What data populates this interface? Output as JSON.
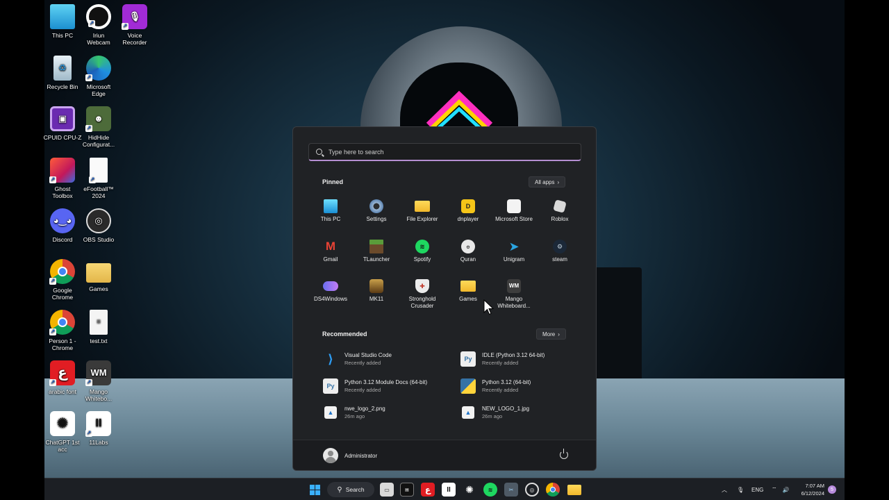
{
  "desktop": {
    "icons": [
      {
        "label": "This PC",
        "icon": "monitor-icon"
      },
      {
        "label": "Iriun\nWebcam",
        "icon": "webcam-icon"
      },
      {
        "label": "Voice\nRecorder",
        "icon": "microphone-icon"
      },
      {
        "label": "Recycle Bin",
        "icon": "recycle-bin-icon"
      },
      {
        "label": "Microsoft\nEdge",
        "icon": "edge-icon"
      },
      {
        "label": "CPUID CPU-Z",
        "icon": "cpu-z-icon"
      },
      {
        "label": "HidHide\nConfigurat...",
        "icon": "hidhide-icon"
      },
      {
        "label": "Ghost\nToolbox",
        "icon": "ghost-toolbox-icon"
      },
      {
        "label": "eFootball™\n2024",
        "icon": "document-icon"
      },
      {
        "label": "Discord",
        "icon": "discord-icon"
      },
      {
        "label": "OBS Studio",
        "icon": "obs-icon"
      },
      {
        "label": "Google\nChrome",
        "icon": "chrome-icon"
      },
      {
        "label": "Games",
        "icon": "folder-icon"
      },
      {
        "label": "Person 1 -\nChrome",
        "icon": "chrome-profile-icon"
      },
      {
        "label": "test.txt",
        "icon": "text-file-icon"
      },
      {
        "label": "arabic font",
        "icon": "arabic-font-icon"
      },
      {
        "label": "Mango\nWhitebo...",
        "icon": "mango-whiteboard-icon",
        "glyph": "WM"
      },
      {
        "label": "ChatGPT 1st\nacc",
        "icon": "chatgpt-icon"
      },
      {
        "label": "11Labs",
        "icon": "elevenlabs-icon",
        "glyph": "II"
      }
    ]
  },
  "start_menu": {
    "search_placeholder": "Type here to search",
    "pinned_title": "Pinned",
    "all_apps_label": "All apps",
    "pinned": [
      {
        "label": "This PC",
        "icon": "monitor-icon"
      },
      {
        "label": "Settings",
        "icon": "gear-icon"
      },
      {
        "label": "File Explorer",
        "icon": "folder-icon"
      },
      {
        "label": "dnplayer",
        "icon": "ldplayer-icon"
      },
      {
        "label": "Microsoft Store",
        "icon": "store-icon"
      },
      {
        "label": "Roblox",
        "icon": "roblox-icon"
      },
      {
        "label": "Gmail",
        "icon": "gmail-icon",
        "glyph": "M"
      },
      {
        "label": "TLauncher",
        "icon": "tlauncher-icon"
      },
      {
        "label": "Spotify",
        "icon": "spotify-icon"
      },
      {
        "label": "Quran",
        "icon": "quran-icon"
      },
      {
        "label": "Unigram",
        "icon": "telegram-icon"
      },
      {
        "label": "steam",
        "icon": "steam-icon"
      },
      {
        "label": "DS4Windows",
        "icon": "gamepad-icon"
      },
      {
        "label": "MK11",
        "icon": "mk11-icon"
      },
      {
        "label": "Stronghold\nCrusader",
        "icon": "shield-icon"
      },
      {
        "label": "Games",
        "icon": "folder-icon"
      },
      {
        "label": "Mango\nWhiteboard...",
        "icon": "mango-whiteboard-icon",
        "glyph": "WM"
      }
    ],
    "recommended_title": "Recommended",
    "more_label": "More",
    "recommended": [
      {
        "title": "Visual Studio Code",
        "sub": "Recently added",
        "icon": "vscode-icon"
      },
      {
        "title": "IDLE (Python 3.12 64-bit)",
        "sub": "Recently added",
        "icon": "python-idle-icon"
      },
      {
        "title": "Python 3.12 Module Docs (64-bit)",
        "sub": "Recently added",
        "icon": "python-docs-icon"
      },
      {
        "title": "Python 3.12 (64-bit)",
        "sub": "Recently added",
        "icon": "python-icon"
      },
      {
        "title": "nwe_logo_2.png",
        "sub": "26m ago",
        "icon": "image-file-icon"
      },
      {
        "title": "NEW_LOGO_1.jpg",
        "sub": "26m ago",
        "icon": "image-file-icon"
      }
    ],
    "user_name": "Administrator"
  },
  "taskbar": {
    "search_label": "Search",
    "language": "ENG",
    "time": "7:07 AM",
    "date": "6/12/2024",
    "notification_count": "5",
    "accent": "#0078d4"
  }
}
